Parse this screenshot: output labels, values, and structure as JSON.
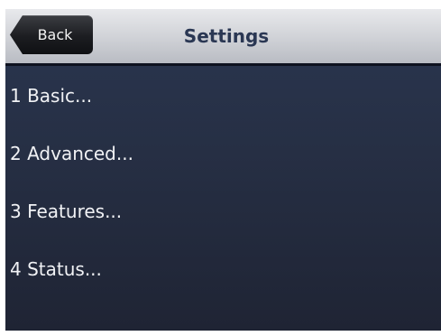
{
  "header": {
    "back_label": "Back",
    "title": "Settings"
  },
  "menu": {
    "items": [
      {
        "label": "1 Basic..."
      },
      {
        "label": "2 Advanced..."
      },
      {
        "label": "3 Features..."
      },
      {
        "label": "4 Status..."
      }
    ]
  }
}
